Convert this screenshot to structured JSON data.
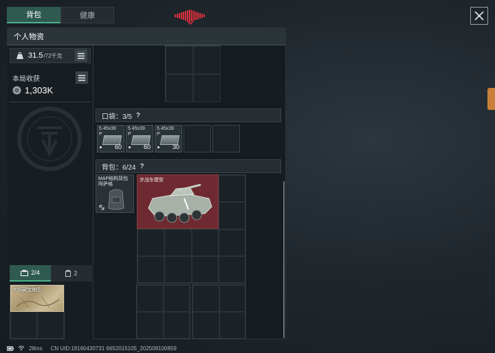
{
  "tabs": {
    "inventory": "背包",
    "health": "健康"
  },
  "panel": {
    "title": "个人物资"
  },
  "weight": {
    "current": "31.5",
    "max": "/72千克"
  },
  "income": {
    "label": "本局收获",
    "value": "1,303K"
  },
  "pockets": {
    "label": "口袋：3/5",
    "help": "?",
    "items": [
      {
        "name": "5.45x39\nP",
        "count": "60"
      },
      {
        "name": "5.45x39\nP",
        "count": "60"
      },
      {
        "name": "5.45x39\nP",
        "count": "30"
      }
    ]
  },
  "backpack": {
    "label": "背包：6/24",
    "help": "?",
    "equipped_name": "MAP结构背包\n阿萨格",
    "vehicle_item": "步战车模型"
  },
  "container": {
    "tab_a": "2/4",
    "tab_b": "2",
    "item_label": "大坝藏宝地图"
  },
  "status": {
    "ping": "28ms",
    "uid": "CN UID:18160430731 6652015105_202508100859"
  },
  "colors": {
    "accent": "#49b48b",
    "tab_active": "#2f5a50",
    "vehicle_bg": "#6e2a30",
    "signal": "#e0303c"
  }
}
